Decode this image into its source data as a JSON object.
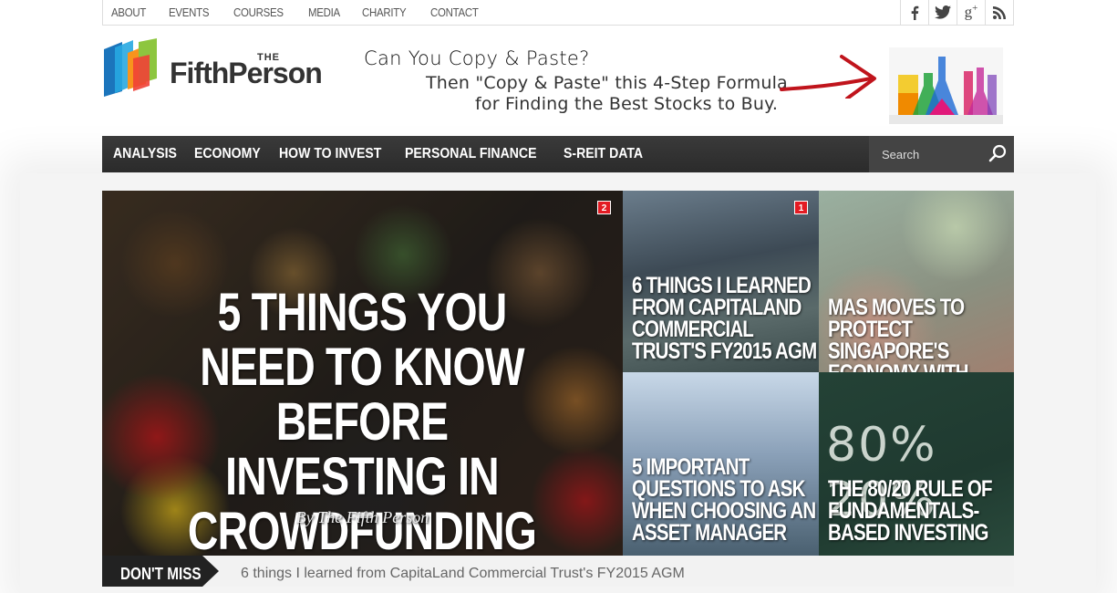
{
  "topbar": {
    "links": [
      "ABOUT",
      "EVENTS",
      "COURSES",
      "MEDIA",
      "CHARITY",
      "CONTACT"
    ],
    "social": [
      {
        "icon": "facebook-icon",
        "glyph": "f"
      },
      {
        "icon": "twitter-icon",
        "glyph": "🐦"
      },
      {
        "icon": "google-plus-icon",
        "glyph": "g+"
      },
      {
        "icon": "rss-icon",
        "glyph": "⟟"
      }
    ]
  },
  "logo": {
    "the": "THE",
    "name": "FifthPerson"
  },
  "banner": {
    "line1": "Can You Copy & Paste?",
    "line2": "Then \"Copy & Paste\" this 4-Step Formula",
    "line3": "for Finding the Best Stocks to Buy."
  },
  "nav": {
    "items": [
      "ANALYSIS",
      "ECONOMY",
      "HOW TO INVEST",
      "PERSONAL FINANCE",
      "S-REIT DATA"
    ],
    "search_placeholder": "Search"
  },
  "featured": {
    "main": {
      "title": "5 THINGS YOU NEED TO KNOW BEFORE INVESTING IN CROWDFUNDING",
      "byline": "By The Fifth Person",
      "badge": "2"
    },
    "tiles": [
      {
        "title": "6 THINGS I LEARNED FROM CAPITALAND COMMERCIAL TRUST'S FY2015 AGM",
        "badge": "1"
      },
      {
        "title": "MAS MOVES TO PROTECT SINGAPORE'S ECONOMY WITH SURPRISE EASING"
      },
      {
        "title": "5 IMPORTANT QUESTIONS TO ASK WHEN CHOOSING AN ASSET MANAGER"
      },
      {
        "title": "THE 80/20 RULE OF FUNDAMENTALS-BASED INVESTING",
        "chalk": "80%  20%"
      }
    ]
  },
  "dont_miss": {
    "label": "DON'T MISS",
    "headline": "6 things I learned from CapitaLand Commercial Trust's FY2015 AGM"
  },
  "colors": {
    "nav_bg": "#2f2f2f",
    "badge": "#e31b23",
    "arrow": "#c0141c"
  }
}
